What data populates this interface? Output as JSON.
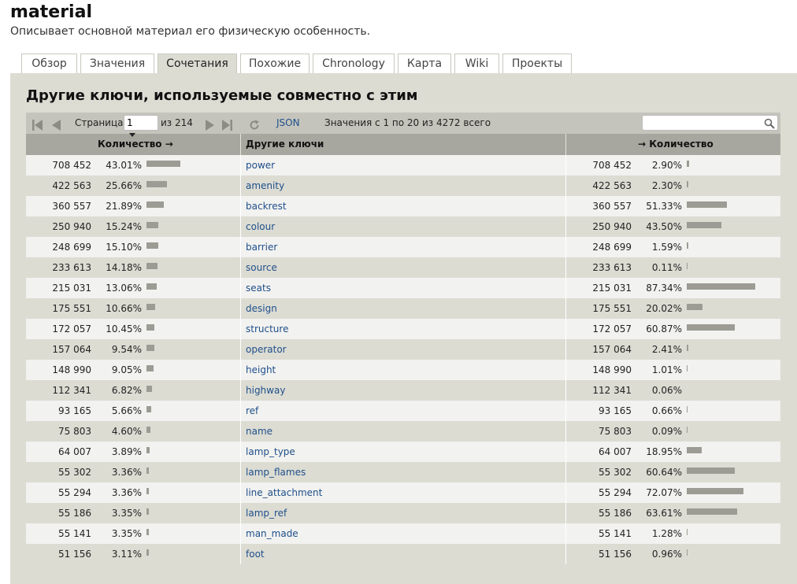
{
  "header": {
    "title": "material",
    "description": "Описывает основной материал его физическую особенность."
  },
  "tabs": [
    {
      "label": "Обзор"
    },
    {
      "label": "Значения"
    },
    {
      "label": "Сочетания"
    },
    {
      "label": "Похожие"
    },
    {
      "label": "Chronology"
    },
    {
      "label": "Карта"
    },
    {
      "label": "Wiki"
    },
    {
      "label": "Проекты"
    }
  ],
  "active_tab": "Сочетания",
  "section": {
    "title": "Другие ключи, используемые совместно с этим"
  },
  "toolbar": {
    "page_label": "Страница",
    "page_value": "1",
    "of_pages": "из 214",
    "json_label": "JSON",
    "summary": "Значения с 1 по 20 из 4272 всего",
    "search_placeholder": ""
  },
  "columns": {
    "count_left": "Количество →",
    "other_keys": "Другие ключи",
    "count_right": "→ Количество"
  },
  "rows": [
    {
      "count": "708 452",
      "pct": "43.01%",
      "pct_val": 43.01,
      "key": "power",
      "count2": "708 452",
      "pct2": "2.90%",
      "pct2_val": 2.9
    },
    {
      "count": "422 563",
      "pct": "25.66%",
      "pct_val": 25.66,
      "key": "amenity",
      "count2": "422 563",
      "pct2": "2.30%",
      "pct2_val": 2.3
    },
    {
      "count": "360 557",
      "pct": "21.89%",
      "pct_val": 21.89,
      "key": "backrest",
      "count2": "360 557",
      "pct2": "51.33%",
      "pct2_val": 51.33
    },
    {
      "count": "250 940",
      "pct": "15.24%",
      "pct_val": 15.24,
      "key": "colour",
      "count2": "250 940",
      "pct2": "43.50%",
      "pct2_val": 43.5
    },
    {
      "count": "248 699",
      "pct": "15.10%",
      "pct_val": 15.1,
      "key": "barrier",
      "count2": "248 699",
      "pct2": "1.59%",
      "pct2_val": 1.59
    },
    {
      "count": "233 613",
      "pct": "14.18%",
      "pct_val": 14.18,
      "key": "source",
      "count2": "233 613",
      "pct2": "0.11%",
      "pct2_val": 0.11
    },
    {
      "count": "215 031",
      "pct": "13.06%",
      "pct_val": 13.06,
      "key": "seats",
      "count2": "215 031",
      "pct2": "87.34%",
      "pct2_val": 87.34
    },
    {
      "count": "175 551",
      "pct": "10.66%",
      "pct_val": 10.66,
      "key": "design",
      "count2": "175 551",
      "pct2": "20.02%",
      "pct2_val": 20.02
    },
    {
      "count": "172 057",
      "pct": "10.45%",
      "pct_val": 10.45,
      "key": "structure",
      "count2": "172 057",
      "pct2": "60.87%",
      "pct2_val": 60.87
    },
    {
      "count": "157 064",
      "pct": "9.54%",
      "pct_val": 9.54,
      "key": "operator",
      "count2": "157 064",
      "pct2": "2.41%",
      "pct2_val": 2.41
    },
    {
      "count": "148 990",
      "pct": "9.05%",
      "pct_val": 9.05,
      "key": "height",
      "count2": "148 990",
      "pct2": "1.01%",
      "pct2_val": 1.01
    },
    {
      "count": "112 341",
      "pct": "6.82%",
      "pct_val": 6.82,
      "key": "highway",
      "count2": "112 341",
      "pct2": "0.06%",
      "pct2_val": 0.06
    },
    {
      "count": "93 165",
      "pct": "5.66%",
      "pct_val": 5.66,
      "key": "ref",
      "count2": "93 165",
      "pct2": "0.66%",
      "pct2_val": 0.66
    },
    {
      "count": "75 803",
      "pct": "4.60%",
      "pct_val": 4.6,
      "key": "name",
      "count2": "75 803",
      "pct2": "0.09%",
      "pct2_val": 0.09
    },
    {
      "count": "64 007",
      "pct": "3.89%",
      "pct_val": 3.89,
      "key": "lamp_type",
      "count2": "64 007",
      "pct2": "18.95%",
      "pct2_val": 18.95
    },
    {
      "count": "55 302",
      "pct": "3.36%",
      "pct_val": 3.36,
      "key": "lamp_flames",
      "count2": "55 302",
      "pct2": "60.64%",
      "pct2_val": 60.64
    },
    {
      "count": "55 294",
      "pct": "3.36%",
      "pct_val": 3.36,
      "key": "line_attachment",
      "count2": "55 294",
      "pct2": "72.07%",
      "pct2_val": 72.07
    },
    {
      "count": "55 186",
      "pct": "3.35%",
      "pct_val": 3.35,
      "key": "lamp_ref",
      "count2": "55 186",
      "pct2": "63.61%",
      "pct2_val": 63.61
    },
    {
      "count": "55 141",
      "pct": "3.35%",
      "pct_val": 3.35,
      "key": "man_made",
      "count2": "55 141",
      "pct2": "1.28%",
      "pct2_val": 1.28
    },
    {
      "count": "51 156",
      "pct": "3.11%",
      "pct_val": 3.11,
      "key": "foot",
      "count2": "51 156",
      "pct2": "0.96%",
      "pct2_val": 0.96
    }
  ],
  "colors": {
    "panel_bg": "#dcdcd3",
    "header_bg": "#a7a79f",
    "row_light": "#f2f2f0",
    "bar": "#9c9c94",
    "link": "#1f4f8a"
  }
}
